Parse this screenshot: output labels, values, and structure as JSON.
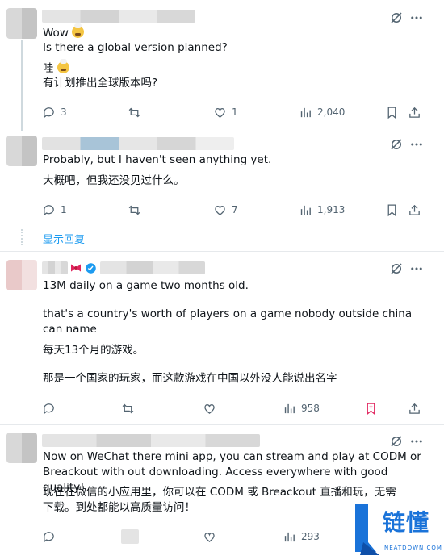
{
  "posts": [
    {
      "lines": [
        "Wow",
        "Is there a global version planned?",
        "哇",
        "有计划推出全球版本吗?"
      ],
      "stats": {
        "replies": "3",
        "reposts": "",
        "likes": "1",
        "views": "2,040"
      }
    },
    {
      "lines": [
        "Probably, but I haven't seen anything yet.",
        "大概吧，但我还没见过什么。"
      ],
      "stats": {
        "replies": "1",
        "reposts": "",
        "likes": "7",
        "views": "1,913"
      },
      "show_replies": "显示回复"
    },
    {
      "lines": [
        "13M daily on a game two months old.",
        "that's a country's worth of players on a game nobody outside china can name",
        "每天13个月的游戏。",
        "那是一个国家的玩家，而这款游戏在中国以外没人能说出名字"
      ],
      "stats": {
        "replies": "",
        "reposts": "",
        "likes": "",
        "views": "958"
      }
    },
    {
      "lines": [
        "Now on WeChat there mini app, you can stream and play at CODM or Breackout with out downloading. Access everywhere with good quality!",
        "现在在微信的小应用里，你可以在 CODM 或 Breackout 直播和玩，无需下载。到处都能以高质量访问！"
      ],
      "stats": {
        "replies": "",
        "reposts": "",
        "likes": "",
        "views": "293"
      }
    }
  ],
  "watermark": {
    "brand": "链懂",
    "site": "NEATDOWN.COM"
  },
  "colors": {
    "text": "#0f1419",
    "muted": "#536471",
    "link": "#1d9bf0",
    "verified": "#1d9bf0",
    "border": "#e6e9ec"
  }
}
